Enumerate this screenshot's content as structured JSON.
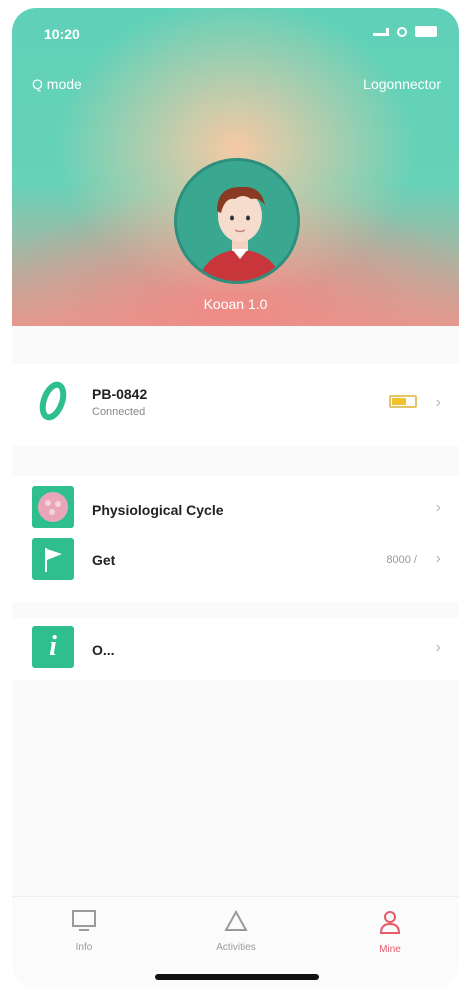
{
  "status_bar": {
    "time": "10:20"
  },
  "header": {
    "left_link": "Q mode",
    "right_link": "Logonnector",
    "username": "Kooan 1.0"
  },
  "device": {
    "name": "PB-0842",
    "subtitle": "Connected",
    "battery_color": "#f2c12e"
  },
  "menu": [
    {
      "label": "Physiological Cycle",
      "value": ""
    },
    {
      "label": "Get",
      "value": "8000 /"
    },
    {
      "label": "O...",
      "value": ""
    }
  ],
  "tabs": [
    {
      "label": "Info",
      "active": false
    },
    {
      "label": "Activities",
      "active": false
    },
    {
      "label": "Mine",
      "active": true
    }
  ],
  "colors": {
    "accent_green": "#2fbf8f",
    "active_tab": "#e65b6b",
    "cycle_pink": "#e9a6b8"
  }
}
